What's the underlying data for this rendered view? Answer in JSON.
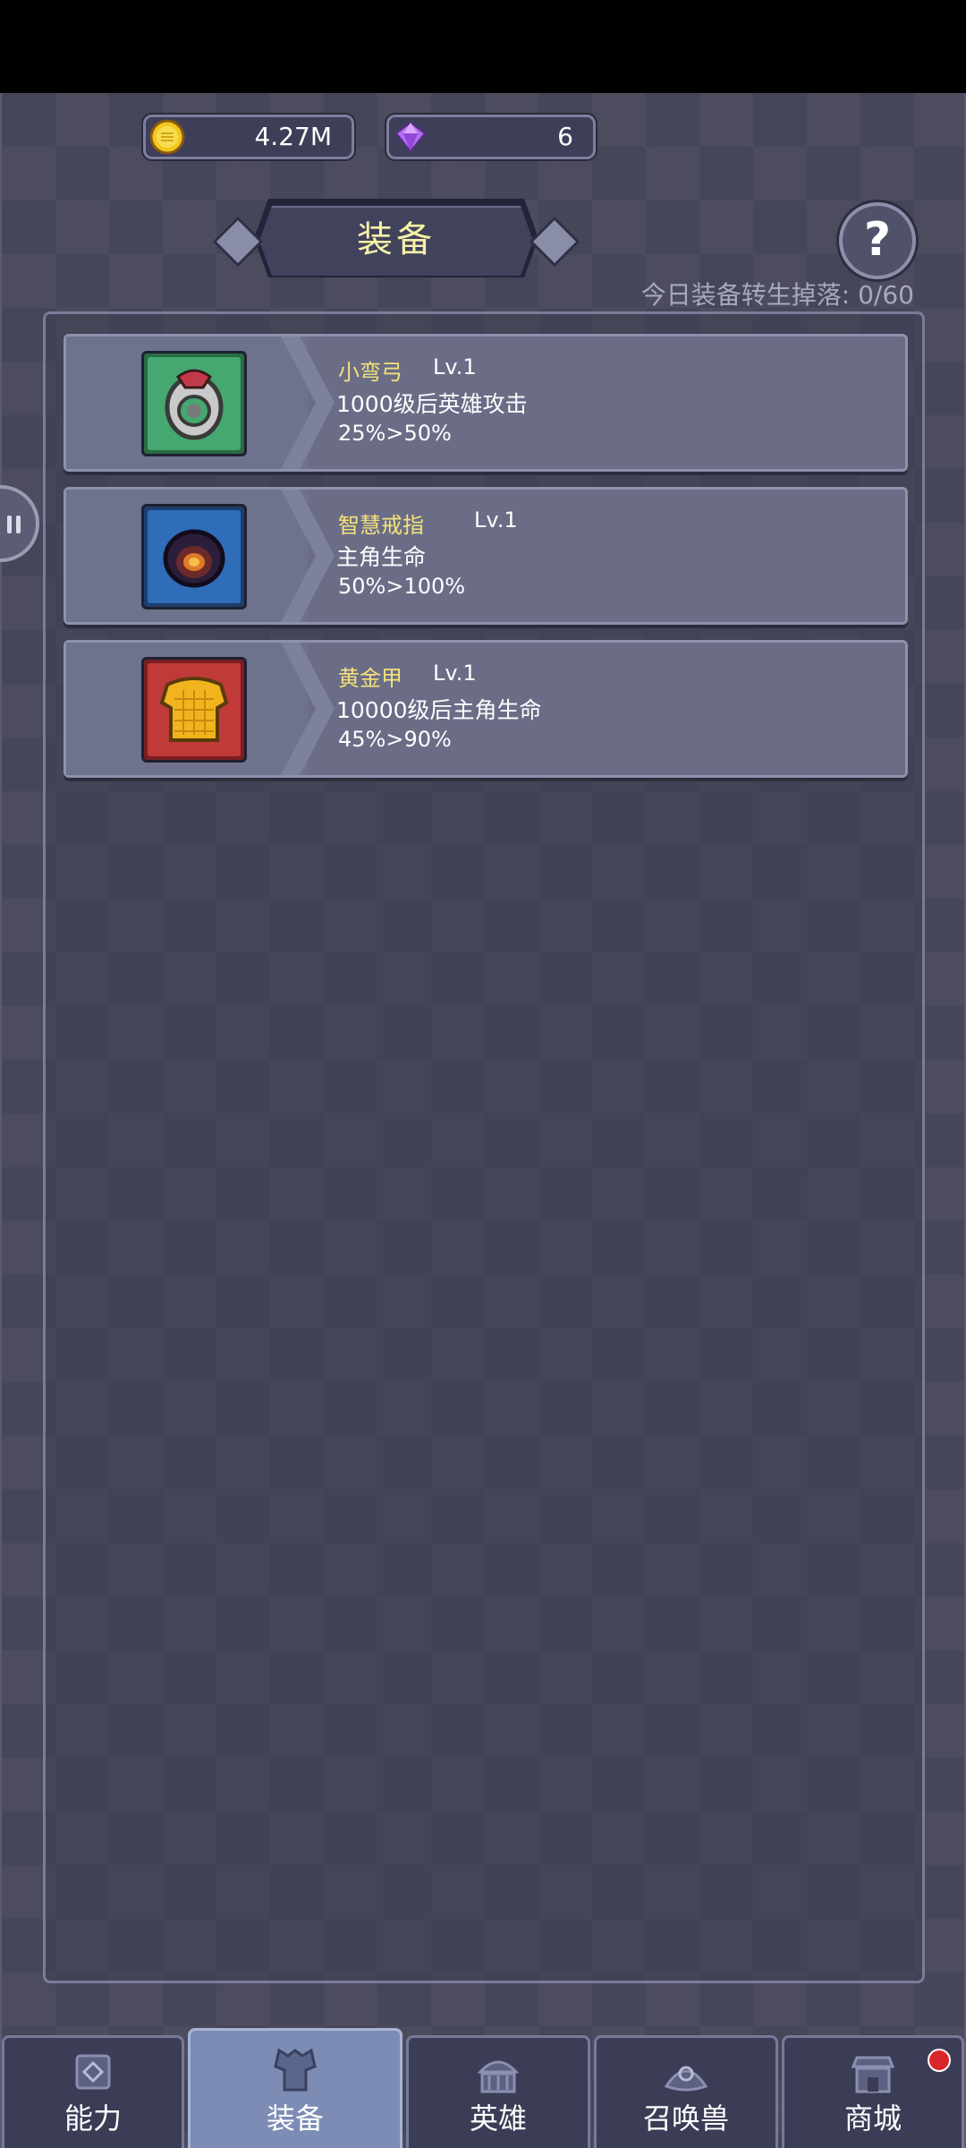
{
  "currency": {
    "gold": {
      "value": "4.27M",
      "icon": "gold-coin-icon",
      "color": "#f2c81e"
    },
    "gem": {
      "value": "6",
      "icon": "purple-gem-icon",
      "color": "#b36df0"
    }
  },
  "header": {
    "title": "装备",
    "help_label": "?",
    "daily_drop_text": "今日装备转生掉落: 0/60"
  },
  "equipment": [
    {
      "name": "小弯弓",
      "level": "Lv.1",
      "desc": "1000级后英雄攻击",
      "effect": "25%>50%",
      "icon": "bow-icon",
      "frame_color": "#45a871"
    },
    {
      "name": "智慧戒指",
      "level": "Lv.1",
      "desc": "主角生命",
      "effect": "50%>100%",
      "icon": "ring-icon",
      "frame_color": "#2f6db8"
    },
    {
      "name": "黄金甲",
      "level": "Lv.1",
      "desc": "10000级后主角生命",
      "effect": "45%>90%",
      "icon": "golden-armor-icon",
      "frame_color": "#c03a3a"
    }
  ],
  "nav": {
    "tabs": [
      {
        "label": "能力",
        "icon": "ability-icon",
        "active": false
      },
      {
        "label": "装备",
        "icon": "armor-icon",
        "active": true
      },
      {
        "label": "英雄",
        "icon": "hero-hall-icon",
        "active": false
      },
      {
        "label": "召唤兽",
        "icon": "summon-icon",
        "active": false
      },
      {
        "label": "商城",
        "icon": "shop-icon",
        "active": false,
        "badge": true
      }
    ]
  }
}
